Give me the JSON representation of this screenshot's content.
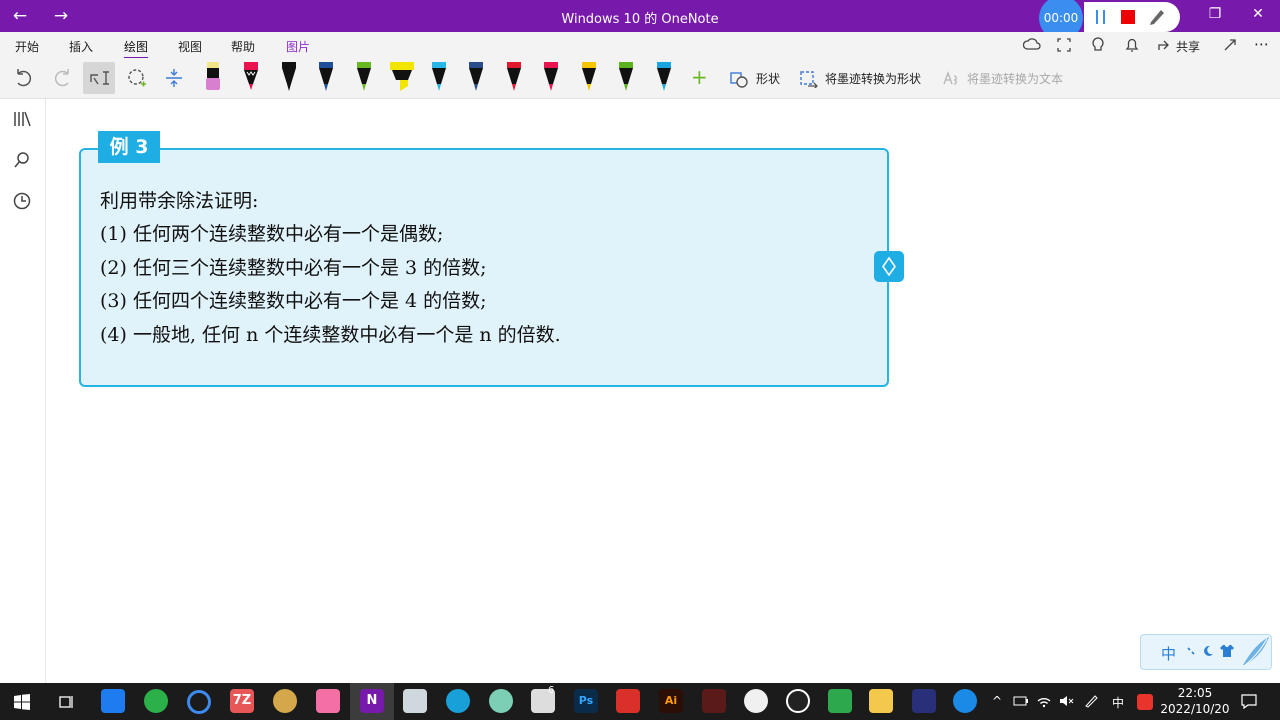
{
  "window": {
    "title": "Windows 10 的 OneNote",
    "back_glyph": "←",
    "forward_glyph": "→",
    "restore_glyph": "❐",
    "close_glyph": "✕"
  },
  "recorder": {
    "timer": "00:00"
  },
  "menu": {
    "items": [
      {
        "label": "开始"
      },
      {
        "label": "插入"
      },
      {
        "label": "绘图"
      },
      {
        "label": "视图"
      },
      {
        "label": "帮助"
      },
      {
        "label": "图片"
      }
    ],
    "share_label": "共享",
    "more_glyph": "⋯"
  },
  "toolbar": {
    "add_glyph": "+",
    "shapes_label": "形状",
    "ink_to_shape_label": "将墨迹转换为形状",
    "ink_to_text_label": "将墨迹转换为文本",
    "pens": [
      {
        "icon": "marker-pen-icon",
        "color": "#d97fd0"
      },
      {
        "icon": "pencil-pen-icon",
        "color": "#e8134f"
      },
      {
        "icon": "pen-icon",
        "color": "#111111"
      },
      {
        "icon": "pen-icon",
        "color": "#1f4f9a"
      },
      {
        "icon": "pen-icon",
        "color": "#6ab821"
      },
      {
        "icon": "highlighter-icon",
        "color": "#f2e600"
      },
      {
        "icon": "pen-icon",
        "color": "#27b6e6"
      },
      {
        "icon": "pen-icon",
        "color": "#2a4c88"
      },
      {
        "icon": "pen-icon",
        "color": "#e0182d"
      },
      {
        "icon": "pen-icon",
        "color": "#e8134f"
      },
      {
        "icon": "pen-icon",
        "color": "#f5c500"
      },
      {
        "icon": "pen-icon",
        "color": "#5bb21e"
      },
      {
        "icon": "pen-icon",
        "color": "#19a6e0"
      }
    ]
  },
  "example": {
    "tag": "例 3",
    "lines": [
      "利用带余除法证明:",
      "(1) 任何两个连续整数中必有一个是偶数;",
      "(2) 任何三个连续整数中必有一个是 3 的倍数;",
      "(3) 任何四个连续整数中必有一个是 4 的倍数;",
      "(4) 一般地, 任何 n 个连续整数中必有一个是 n 的倍数."
    ]
  },
  "ime": {
    "label": "中"
  },
  "taskbar": {
    "time": "22:05",
    "date": "2022/10/20",
    "tray_zh": "中",
    "app_7z": "7Z",
    "app_ps": "Ps",
    "app_ai": "Ai",
    "badge_6": "6"
  },
  "colors": {
    "onenote_purple": "#7719aa",
    "box_fill": "#e1f3fa",
    "box_border": "#25b4e3",
    "tag_fill": "#1faee4"
  }
}
